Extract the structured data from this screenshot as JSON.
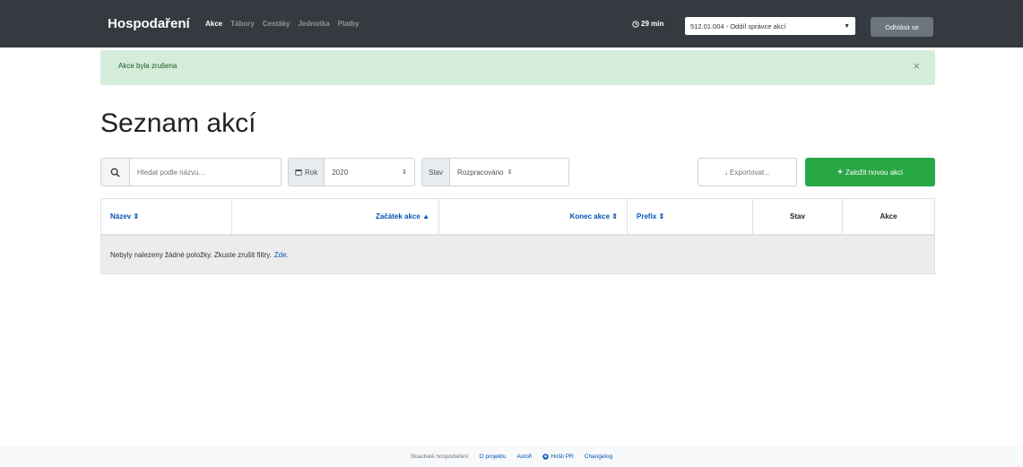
{
  "navbar": {
    "brand": "Hospodaření",
    "links": [
      "Akce",
      "Tábory",
      "Cestáky",
      "Jednotka",
      "Platby"
    ],
    "timer": "29 min",
    "unit_select": "512.01.004 - Oddíl správce akcí",
    "logout": "Odhlásit se"
  },
  "alert": {
    "message": "Akce byla zrušena",
    "close": "×"
  },
  "page": {
    "title": "Seznam akcí"
  },
  "filters": {
    "search_placeholder": "Hledat podle názvu...",
    "year_label": "Rok",
    "year_value": "2020",
    "status_label": "Stav",
    "status_value": "Rozpracováno"
  },
  "buttons": {
    "export": "Exportovat...",
    "new_event": "Založit novou akci"
  },
  "table": {
    "columns": [
      "Název",
      "Začátek akce",
      "Konec akce",
      "Prefix",
      "Stav",
      "Akce"
    ],
    "empty_message": "Nebyly nalezeny žádné položky. Zkuste zrušit filtry.",
    "empty_link": "Zde."
  },
  "footer": {
    "text": "Skautské hospodaření",
    "links": [
      "O projektu",
      "Autoři",
      "Hošli PR",
      "Changelog"
    ]
  },
  "icons": {
    "timer": "clock-icon",
    "search": "search-icon",
    "calendar": "calendar-icon",
    "export": "download-icon",
    "add": "plus-icon",
    "github": "github-icon"
  },
  "colors": {
    "navbar": "#343a40",
    "alert_bg": "#d4edda",
    "primary_action": "#28a745",
    "link": "#0056b3"
  }
}
